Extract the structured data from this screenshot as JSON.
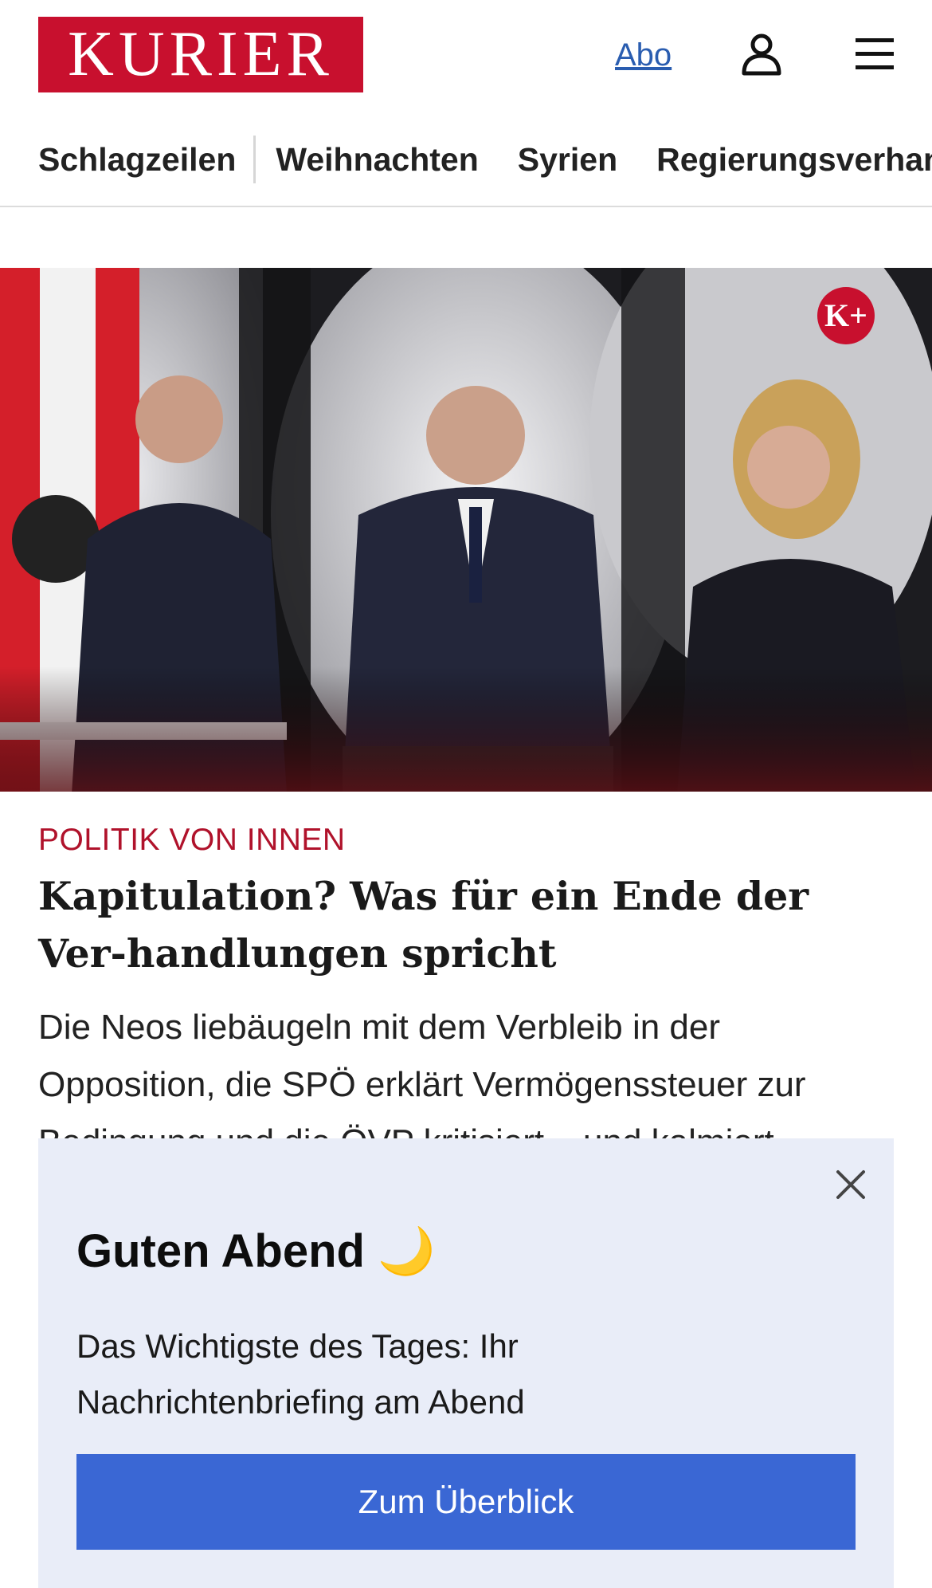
{
  "header": {
    "logo_text": "KURIER",
    "abo_label": "Abo",
    "icons": [
      "user-icon",
      "menu-icon"
    ],
    "brand_color": "#c8102e"
  },
  "nav": {
    "items": [
      "Schlagzeilen",
      "Weihnachten",
      "Syrien",
      "Regierungsverhandlungen"
    ]
  },
  "hero": {
    "badge": "K+"
  },
  "article": {
    "kicker": "POLITIK VON INNEN",
    "headline": "Kapitulation? Was für ein Ende der Ver-handlungen spricht",
    "teaser": "Die Neos liebäugeln mit dem Verbleib in der Opposition, die SPÖ erklärt Vermögenssteuer zur Bedingung und die ÖVP kritisiert – und kalmiert"
  },
  "overlay": {
    "title": "Guten Abend",
    "title_icon": "🌙",
    "text": "Das Wichtigste des Tages: Ihr Nachrichtenbriefing am Abend",
    "button_label": "Zum Überblick",
    "button_color": "#3a67d4",
    "background_color": "#e9edf8"
  }
}
